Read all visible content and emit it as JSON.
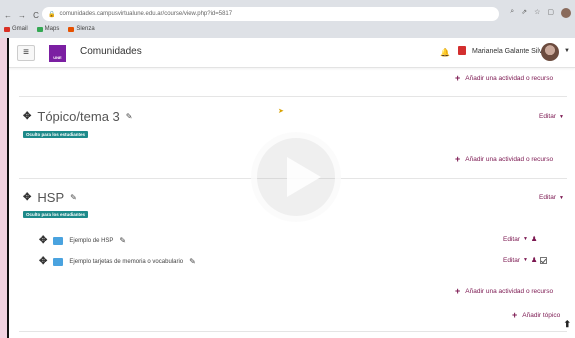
{
  "browser": {
    "url": "comunidades.campusvirtualune.edu.ar/course/view.php?id=5817",
    "bookmarks": [
      {
        "label": "Gmail",
        "color": "#d93025"
      },
      {
        "label": "Maps",
        "color": "#34a853"
      },
      {
        "label": "Slenza",
        "color": "#e65100"
      }
    ]
  },
  "header": {
    "logo_text": "UNE",
    "site_name": "Comunidades",
    "user_name": "Marianela Galante Silva"
  },
  "course": {
    "add_activity_top": "Añadir una actividad o recurso",
    "sections": [
      {
        "title": "Tópico/tema 3",
        "badge": "Oculto para los estudiantes",
        "edit": "Editar",
        "add_activity": "Añadir una actividad o recurso"
      },
      {
        "title": "HSP",
        "badge": "Oculto para los estudiantes",
        "edit": "Editar",
        "activities": [
          {
            "name": "Ejemplo de HSP",
            "edit": "Editar"
          },
          {
            "name": "Ejemplo tarjetas de memoria o vocabulario",
            "edit": "Editar"
          }
        ],
        "add_activity": "Añadir una actividad o recurso"
      }
    ],
    "add_topic": "Añadir tópico"
  },
  "colors": {
    "accent": "#7b1750",
    "badge": "#1d8a8a",
    "brand": "#7b1fa2"
  }
}
